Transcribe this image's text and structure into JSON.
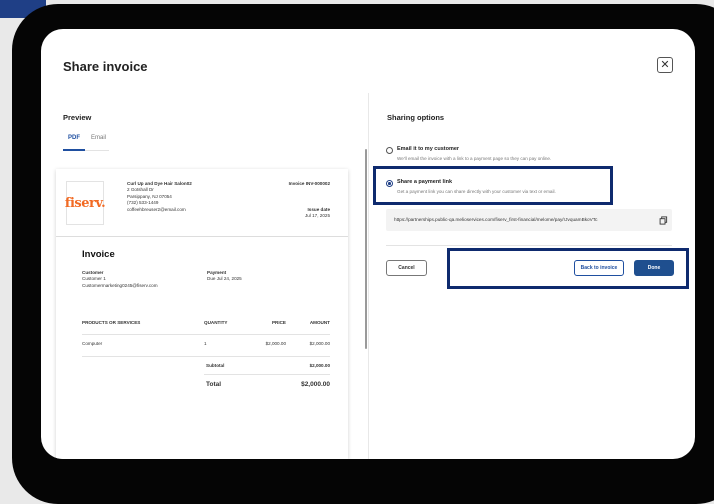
{
  "modal": {
    "title": "Share invoice",
    "close_glyph": "✕"
  },
  "preview": {
    "title": "Preview",
    "tabs": [
      {
        "label": "PDF",
        "active": true
      },
      {
        "label": "Email",
        "active": false
      }
    ]
  },
  "invoice": {
    "logo_text": "fiserv.",
    "business": {
      "name": "Curl Up and Dye Hair Salon02",
      "address1": "2 Gotshall Dr",
      "address2": "Parsippany, NJ 07054",
      "phone": "(732) 533-1449",
      "email": "coffeehbreuser2@email.com"
    },
    "number_label": "Invoice INV-000002",
    "issue_date_label": "Issue date",
    "issue_date": "Jul 17, 2025",
    "heading": "Invoice",
    "customer_label": "Customer",
    "customer_name": "Customer 1",
    "customer_email": "Customermarketing0245@fiserv.com",
    "payment_label": "Payment",
    "payment_due": "Due Jul 24, 2025",
    "columns": [
      "PRODUCTS OR SERVICES",
      "QUANTITY",
      "PRICE",
      "AMOUNT"
    ],
    "items": [
      {
        "name": "Computer",
        "quantity": "1",
        "price": "$2,000.00",
        "amount": "$2,000.00"
      }
    ],
    "subtotal_label": "Subtotal",
    "subtotal": "$2,000.00",
    "total_label": "Total",
    "total": "$2,000.00"
  },
  "sharing": {
    "title": "Sharing options",
    "option_email": {
      "label": "Email it to my customer",
      "desc": "We'll email the invoice with a link to a payment page so they can pay online.",
      "selected": false
    },
    "option_link": {
      "label": "Share a payment link",
      "desc": "Get a payment link you can share directly with your customer via text or email.",
      "selected": true
    },
    "link_url": "https://partnerships.public-qa.melioservices.com/fiserv_first-financial/melome/pay/rJvquamBkoVTc",
    "copy_icon": "copy-icon",
    "cancel_label": "Cancel",
    "back_label": "Back to invoice",
    "done_label": "Done"
  },
  "colors": {
    "accent": "#1f4f8f",
    "highlight": "#0e2a6e",
    "brand_logo": "#f26a23"
  }
}
